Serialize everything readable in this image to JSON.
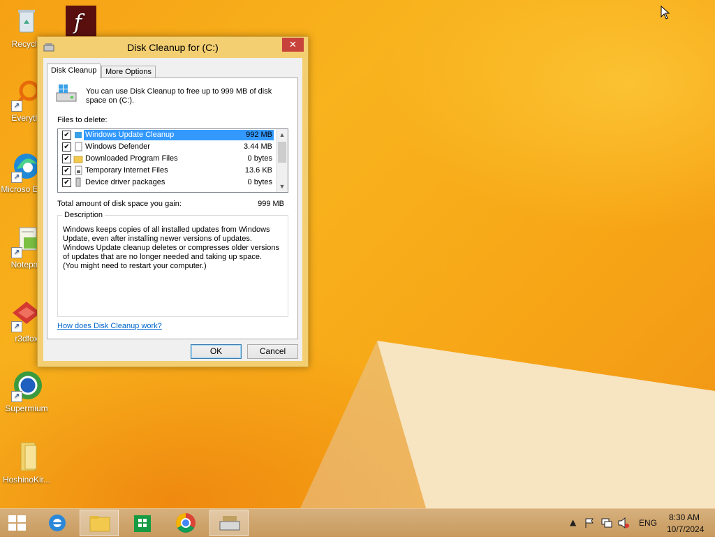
{
  "desktop": {
    "icons": [
      {
        "label": "Recycle",
        "icon": "recycle-bin-icon"
      },
      {
        "label": "",
        "icon": "flash-icon"
      },
      {
        "label": "Everythi",
        "icon": "everything-search-icon"
      },
      {
        "label": "Microso Edge",
        "icon": "edge-icon"
      },
      {
        "label": "Notepac",
        "icon": "notepad-icon"
      },
      {
        "label": "r3dfox",
        "icon": "r3dfox-icon"
      },
      {
        "label": "Supermium",
        "icon": "supermium-icon"
      },
      {
        "label": "HoshinoKir...",
        "icon": "folder-icon"
      }
    ]
  },
  "dialog": {
    "title": "Disk Cleanup for  (C:)",
    "close_glyph": "✕",
    "tabs": [
      {
        "label": "Disk Cleanup",
        "active": true
      },
      {
        "label": "More Options",
        "active": false
      }
    ],
    "intro": "You can use Disk Cleanup to free up to 999 MB of disk space on  (C:).",
    "files_label": "Files to delete:",
    "files": [
      {
        "name": "Windows Update Cleanup",
        "size": "992 MB",
        "checked": true,
        "selected": true,
        "icon": "windows-update-icon"
      },
      {
        "name": "Windows Defender",
        "size": "3.44 MB",
        "checked": true,
        "selected": false,
        "icon": "file-icon"
      },
      {
        "name": "Downloaded Program Files",
        "size": "0 bytes",
        "checked": true,
        "selected": false,
        "icon": "folder-icon"
      },
      {
        "name": "Temporary Internet Files",
        "size": "13.6 KB",
        "checked": true,
        "selected": false,
        "icon": "file-lock-icon"
      },
      {
        "name": "Device driver packages",
        "size": "0 bytes",
        "checked": true,
        "selected": false,
        "icon": "device-icon"
      }
    ],
    "total_label": "Total amount of disk space you gain:",
    "total_value": "999 MB",
    "description_title": "Description",
    "description": "Windows keeps copies of all installed updates from Windows Update, even after installing newer versions of updates. Windows Update cleanup deletes or compresses older versions of updates that are no longer needed and taking up space. (You might need to restart your computer.)",
    "help_link": "How does Disk Cleanup work?",
    "ok_label": "OK",
    "cancel_label": "Cancel"
  },
  "taskbar": {
    "apps": [
      "start-button",
      "internet-explorer-icon",
      "file-explorer-icon",
      "store-icon",
      "chrome-icon",
      "disk-cleanup-icon"
    ],
    "language": "ENG",
    "time": "8:30 AM",
    "date": "10/7/2024"
  },
  "colors": {
    "accent": "#f7a516",
    "selection": "#3399ff",
    "close": "#c7423a",
    "link": "#0066cc"
  }
}
